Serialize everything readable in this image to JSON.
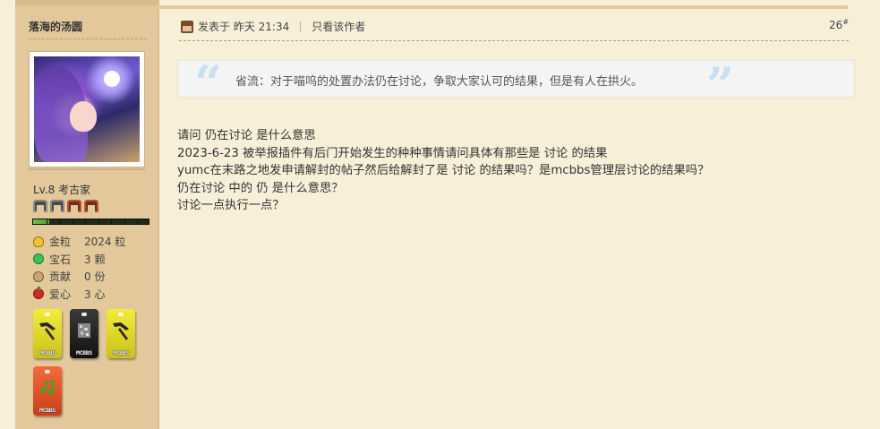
{
  "author": {
    "username": "落海的汤圆",
    "level": "Lv.8 考古家",
    "xp_fraction": 0.14,
    "helmets": [
      "iron",
      "iron",
      "leather",
      "leather"
    ],
    "stats": [
      {
        "icon": "gold-nugget-icon",
        "label": "金粒",
        "value": "2024 粒"
      },
      {
        "icon": "emerald-icon",
        "label": "宝石",
        "value": "3 颗"
      },
      {
        "icon": "contribution-icon",
        "label": "贡献",
        "value": "0 份"
      },
      {
        "icon": "apple-heart-icon",
        "label": "爱心",
        "value": "3 心"
      }
    ],
    "medals": [
      {
        "color": "yellow",
        "icon": "pickaxe-icon",
        "tag": "MCBBS"
      },
      {
        "color": "black",
        "icon": "ore-icon",
        "tag": "MCBBS"
      },
      {
        "color": "yellow",
        "icon": "pickaxe-icon",
        "tag": "MCBBS"
      },
      {
        "color": "orange",
        "icon": "music-note-icon",
        "tag": "MCBBS"
      }
    ]
  },
  "post": {
    "posted_label": "发表于 昨天 21:34",
    "only_author_label": "只看该作者",
    "floor": "26",
    "floor_mark": "#",
    "quote": "省流：对于喵呜的处置办法仍在讨论，争取大家认可的结果，但是有人在拱火。",
    "body_lines": [
      "请问 仍在讨论 是什么意思",
      "2023-6-23 被举报插件有后门开始发生的种种事情请问具体有那些是 讨论 的结果",
      "yumc在末路之地发申请解封的帖子然后给解封了是 讨论 的结果吗？是mcbbs管理层讨论的结果吗？",
      "仍在讨论 中的 仍 是什么意思？",
      "讨论一点执行一点？"
    ]
  },
  "colors": {
    "sidebar_bg": "#e2c89a",
    "page_bg": "#f8efd8",
    "quote_mark": "#c9dff2"
  }
}
